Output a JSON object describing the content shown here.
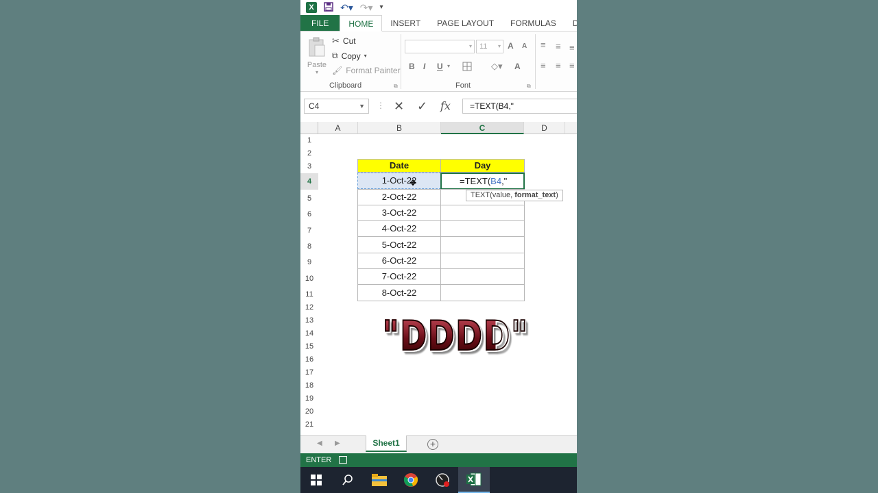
{
  "app": {
    "logo_letter": "X",
    "accent_color": "#217346",
    "status_bar_color": "#217346"
  },
  "ribbon_tabs": [
    "FILE",
    "HOME",
    "INSERT",
    "PAGE LAYOUT",
    "FORMULAS",
    "DATA"
  ],
  "clipboard": {
    "paste_label": "Paste",
    "cut_label": "Cut",
    "copy_label": "Copy",
    "format_painter_label": "Format Painter",
    "group_label": "Clipboard"
  },
  "font": {
    "size_value": "11",
    "group_label": "Font",
    "bold": "B",
    "italic": "I",
    "underline": "U",
    "grow": "A",
    "shrink": "A"
  },
  "formula_bar": {
    "name_box": "C4",
    "fx_label": "fx",
    "formula": "=TEXT(B4,\""
  },
  "columns": [
    "A",
    "B",
    "C",
    "D"
  ],
  "rows": [
    "1",
    "2",
    "3",
    "4",
    "5",
    "6",
    "7",
    "8",
    "9",
    "10",
    "11",
    "12",
    "13",
    "14",
    "15",
    "16",
    "17",
    "18",
    "19",
    "20",
    "21"
  ],
  "table": {
    "headers": [
      "Date",
      "Day"
    ],
    "dates": [
      "1-Oct-22",
      "2-Oct-22",
      "3-Oct-22",
      "4-Oct-22",
      "5-Oct-22",
      "6-Oct-22",
      "7-Oct-22",
      "8-Oct-22"
    ],
    "editing_cell": "=TEXT(",
    "editing_ref": "B4",
    "editing_tail": ",\"",
    "header_color": "#ffff00"
  },
  "tooltip": {
    "prefix": "TEXT(value, ",
    "bold_part": "format_text",
    "suffix": ")"
  },
  "banner_text": "\"DDDD\"",
  "sheet_tab": "Sheet1",
  "status_text": "ENTER",
  "taskbar_icons": [
    "windows-start-icon",
    "search-icon",
    "file-explorer-icon",
    "chrome-icon",
    "screen-recorder-icon",
    "excel-icon"
  ]
}
